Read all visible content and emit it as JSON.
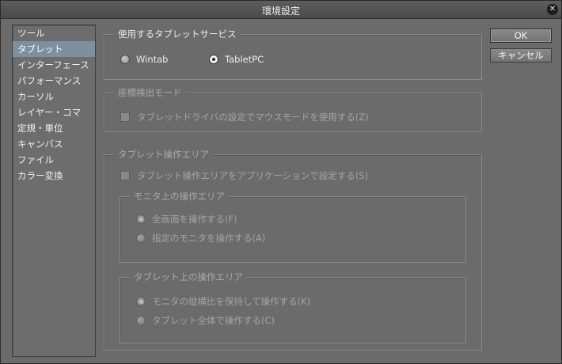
{
  "dialog": {
    "title": "環境設定"
  },
  "sidebar": {
    "items": [
      "ツール",
      "タブレット",
      "インターフェース",
      "パフォーマンス",
      "カーソル",
      "レイヤー・コマ",
      "定規・単位",
      "キャンバス",
      "ファイル",
      "カラー変換"
    ],
    "selected_index": 1
  },
  "tablet_service": {
    "legend": "使用するタブレットサービス",
    "options": [
      {
        "label": "Wintab",
        "selected": false
      },
      {
        "label": "TabletPC",
        "selected": true
      }
    ]
  },
  "coord_mode": {
    "legend": "座標検出モード",
    "checkbox_label": "タブレットドライバの設定でマウスモードを使用する(Z)",
    "checked": false
  },
  "tablet_area": {
    "legend": "タブレット操作エリア",
    "checkbox_label": "タブレット操作エリアをアプリケーションで設定する(S)",
    "checked": false,
    "monitor_area": {
      "legend": "モニタ上の操作エリア",
      "options": [
        {
          "label": "全画面を操作する(F)",
          "selected": true
        },
        {
          "label": "指定のモニタを操作する(A)",
          "selected": false
        }
      ]
    },
    "tablet_surface": {
      "legend": "タブレット上の操作エリア",
      "options": [
        {
          "label": "モニタの縦横比を保持して操作する(K)",
          "selected": true
        },
        {
          "label": "タブレット全体で操作する(C)",
          "selected": false
        }
      ]
    }
  },
  "buttons": {
    "ok": "OK",
    "cancel": "キャンセル"
  },
  "icons": {
    "close": "close-icon"
  },
  "colors": {
    "background": "#6b6b6b",
    "selection": "#7d8fa1",
    "titlebar": "#4f4f4f"
  }
}
